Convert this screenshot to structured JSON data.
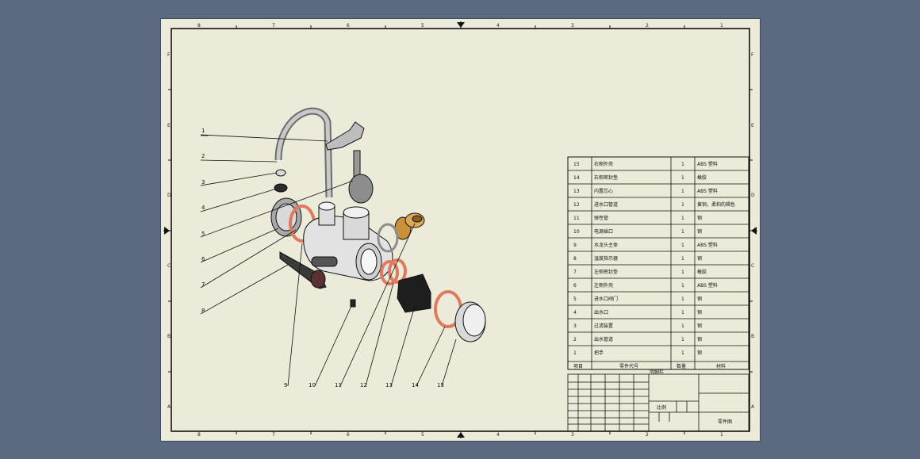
{
  "zones": {
    "top_cols": [
      "8",
      "7",
      "6",
      "5",
      "4",
      "3",
      "2",
      "1"
    ],
    "side_rows": [
      "F",
      "E",
      "D",
      "C",
      "B",
      "A"
    ]
  },
  "balloons": [
    "1",
    "2",
    "3",
    "4",
    "5",
    "6",
    "7",
    "8",
    "9",
    "10",
    "11",
    "12",
    "13",
    "14",
    "15"
  ],
  "bom": {
    "rows": [
      {
        "no": "15",
        "name": "右侧外壳",
        "qty": "1",
        "mat": "ABS 塑料"
      },
      {
        "no": "14",
        "name": "右侧密封垫",
        "qty": "1",
        "mat": "橡胶"
      },
      {
        "no": "13",
        "name": "内置芯心",
        "qty": "1",
        "mat": "ABS 塑料"
      },
      {
        "no": "12",
        "name": "进水口管道",
        "qty": "1",
        "mat": "黄铜，柔和的褐色"
      },
      {
        "no": "11",
        "name": "弹性管",
        "qty": "1",
        "mat": "钢"
      },
      {
        "no": "10",
        "name": "电源插口",
        "qty": "1",
        "mat": "钢"
      },
      {
        "no": "9",
        "name": "水龙头主体",
        "qty": "1",
        "mat": "ABS 塑料"
      },
      {
        "no": "8",
        "name": "温度指示器",
        "qty": "1",
        "mat": "钢"
      },
      {
        "no": "7",
        "name": "左侧密封垫",
        "qty": "1",
        "mat": "橡胶"
      },
      {
        "no": "6",
        "name": "左侧外壳",
        "qty": "1",
        "mat": "ABS 塑料"
      },
      {
        "no": "5",
        "name": "进水口阀门",
        "qty": "1",
        "mat": "钢"
      },
      {
        "no": "4",
        "name": "出水口",
        "qty": "1",
        "mat": "钢"
      },
      {
        "no": "3",
        "name": "过滤装置",
        "qty": "1",
        "mat": "钢"
      },
      {
        "no": "2",
        "name": "出水管道",
        "qty": "1",
        "mat": "钢"
      },
      {
        "no": "1",
        "name": "把手",
        "qty": "1",
        "mat": "钢"
      }
    ],
    "header": {
      "no": "项目",
      "name": "零件代号",
      "qty": "数量",
      "mat": "材料"
    },
    "caption": "明细栏"
  },
  "title_block": {
    "scale_label": "比例",
    "drawing_name": "零件图"
  },
  "colors": {
    "background": "#5b6a80",
    "sheet": "#ecebd9",
    "gasket": "#e07a5f",
    "brass": "#c8913a"
  }
}
